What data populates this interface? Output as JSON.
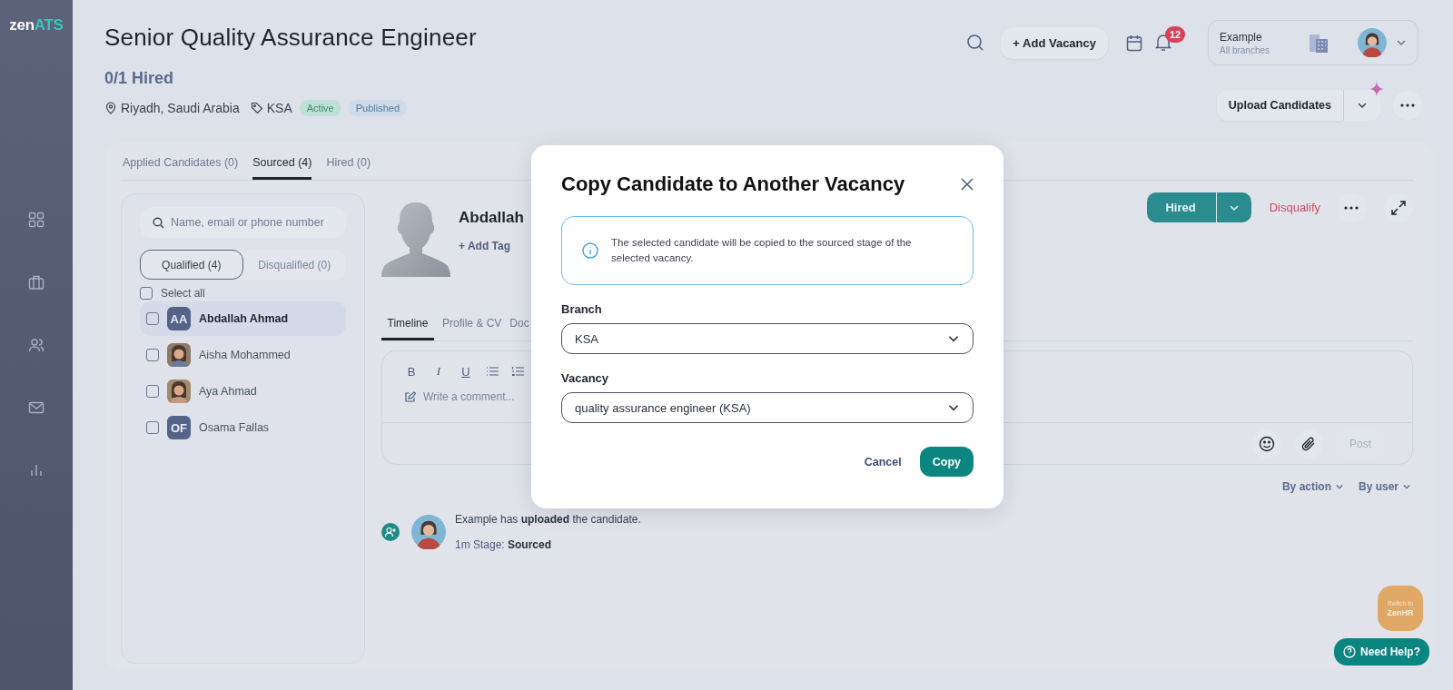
{
  "logo": {
    "primary": "zen",
    "accent": "ATS"
  },
  "header": {
    "title": "Senior Quality Assurance Engineer",
    "hired": "0/1 Hired",
    "location": "Riyadh, Saudi Arabia",
    "tag": "KSA",
    "badges": [
      {
        "label": "Active",
        "kind": "active"
      },
      {
        "label": "Published",
        "kind": "published"
      }
    ]
  },
  "toolbar": {
    "add_vacancy": "+ Add Vacancy",
    "notifications": "12",
    "account": {
      "name": "Example",
      "scope": "All branches"
    },
    "upload": "Upload Candidates"
  },
  "stage_tabs": [
    {
      "label": "Applied Candidates (0)",
      "selected": false
    },
    {
      "label": "Sourced (4)",
      "selected": true
    },
    {
      "label": "Hired (0)",
      "selected": false
    }
  ],
  "candidate_list": {
    "search_placeholder": "Name, email or phone number",
    "filters": [
      {
        "label": "Qualified (4)",
        "selected": true
      },
      {
        "label": "Disqualified (0)",
        "selected": false
      }
    ],
    "select_all": {
      "label": "Select all",
      "checked": false
    },
    "candidates": [
      {
        "name": "Abdallah Ahmad",
        "kind": "initials",
        "initials": "AA",
        "selected": true,
        "checked": false
      },
      {
        "name": "Aisha Mohammed",
        "selected": false,
        "checked": false
      },
      {
        "name": "Aya Ahmad",
        "selected": false,
        "checked": false
      },
      {
        "name": "Osama Fallas",
        "kind": "initials",
        "initials": "OF",
        "selected": false,
        "checked": false
      }
    ]
  },
  "candidate": {
    "name": "Abdallah",
    "add_tag": "+ Add Tag",
    "stage": "Hired",
    "disqualify": "Disqualify",
    "tabs": [
      {
        "label": "Timeline",
        "selected": true
      },
      {
        "label": "Profile & CV",
        "selected": false
      },
      {
        "label": "Doc",
        "selected": false
      }
    ]
  },
  "comment_box": {
    "format_buttons": [
      "B",
      "I",
      "U"
    ],
    "placeholder": "Write a comment...",
    "post": {
      "label": "Post",
      "disabled": true
    }
  },
  "timeline_filters": [
    "By action",
    "By user"
  ],
  "timeline": [
    {
      "text": "Example has **uploaded** the candidate.",
      "meta": "1m Stage: **Sourced**"
    }
  ],
  "modal": {
    "title": "Copy Candidate to Another Vacancy",
    "info": "The selected candidate will be copied to the sourced stage of the selected vacancy.",
    "fields": [
      {
        "label": "Branch",
        "value": "KSA"
      },
      {
        "label": "Vacancy",
        "value": "quality assurance engineer (KSA)"
      }
    ],
    "cancel": "Cancel",
    "confirm": "Copy"
  },
  "switch": {
    "caption": "Switch to",
    "product": "ZenHR"
  },
  "help": "Need Help?"
}
